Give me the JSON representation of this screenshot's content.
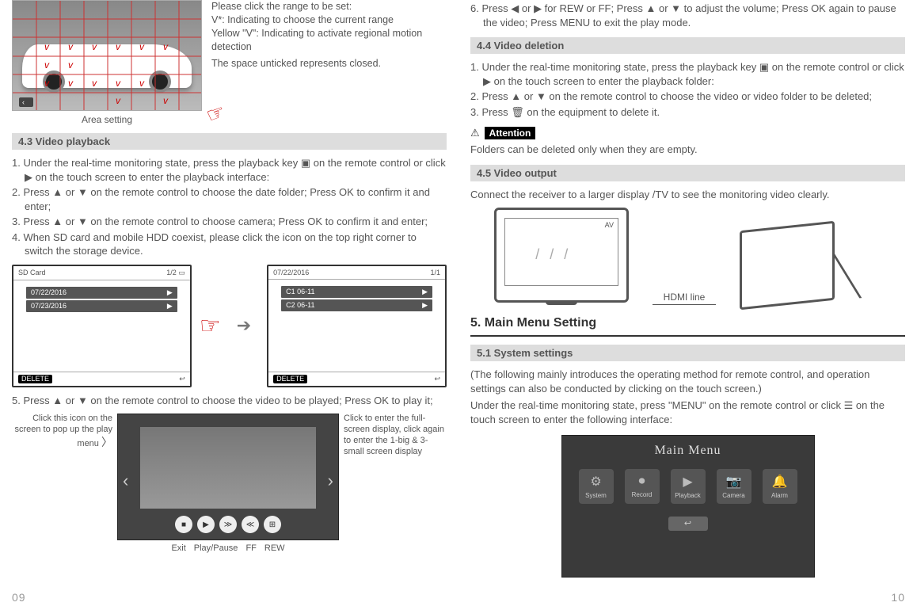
{
  "left": {
    "areaLegend1": "Please click the range to be set:",
    "areaLegend2": "V*: Indicating to choose the current range",
    "areaLegend3": "Yellow \"V\": Indicating to activate regional motion detection",
    "areaLegend4": "The space unticked represents closed.",
    "areaCaption": "Area setting",
    "section43": "4.3  Video playback",
    "steps43": [
      "1. Under the real-time monitoring state, press the playback key ▣ on the remote control or click ▶ on the touch screen to enter the playback interface:",
      "2. Press ▲ or ▼ on the remote control to choose the date folder; Press OK to confirm it and enter;",
      "3. Press ▲ or ▼ on the remote control to choose camera; Press OK to confirm it and enter;",
      "4. When SD card and mobile HDD coexist, please click the icon on the top right corner to switch the storage device."
    ],
    "sdCardTitle": "SD Card",
    "sdPage": "1/2",
    "sdRows": [
      "07/22/2016",
      "07/23/2016"
    ],
    "dateTitle": "07/22/2016",
    "datePage": "1/1",
    "dateRows": [
      "C1 06-11",
      "C2 06-11"
    ],
    "deleteLabel": "DELETE",
    "step5": "5. Press ▲ or ▼ on the remote control to choose the video to be played; Press OK to play it;",
    "calloutLeft": "Click this icon on the screen to pop up the play menu",
    "calloutRight": "Click to enter the full-screen display, click again to enter the 1-big & 3-small screen display",
    "ctrlLabels": {
      "exit": "Exit",
      "play": "Play/Pause",
      "ff": "FF",
      "rew": "REW"
    },
    "pageNum": "09"
  },
  "right": {
    "step6": "6. Press ◀ or ▶ for REW or FF; Press ▲ or ▼ to adjust the volume; Press OK again to pause the video; Press MENU to exit the play mode.",
    "section44": "4.4  Video deletion",
    "steps44": [
      "1. Under the real-time monitoring state, press the playback key ▣ on the remote control or click ▶ on the touch screen to enter the playback folder:",
      "2. Press ▲ or ▼ on the remote control to choose the video or video folder to be deleted;",
      "3. Press 🗑 on the equipment to delete it."
    ],
    "attentionLabel": "Attention",
    "attentionText": "Folders can be deleted only when they are empty.",
    "section45": "4.5  Video output",
    "videoOut": "Connect the receiver to a larger display /TV to see the monitoring video clearly.",
    "av": "AV",
    "hdmi": "HDMI line",
    "section5": "5. Main Menu Setting",
    "section51": "5.1 System settings",
    "sys1": "(The following mainly introduces the operating method for remote control, and operation settings can also be conducted by clicking on the touch screen.)",
    "sys2": "Under the real-time monitoring state, press \"MENU\" on the remote control or click ☰ on the touch screen to enter the following interface:",
    "mainMenu": {
      "title": "Main  Menu",
      "items": [
        "System",
        "Record",
        "Playback",
        "Camera",
        "Alarm"
      ]
    },
    "pageNum": "10"
  }
}
